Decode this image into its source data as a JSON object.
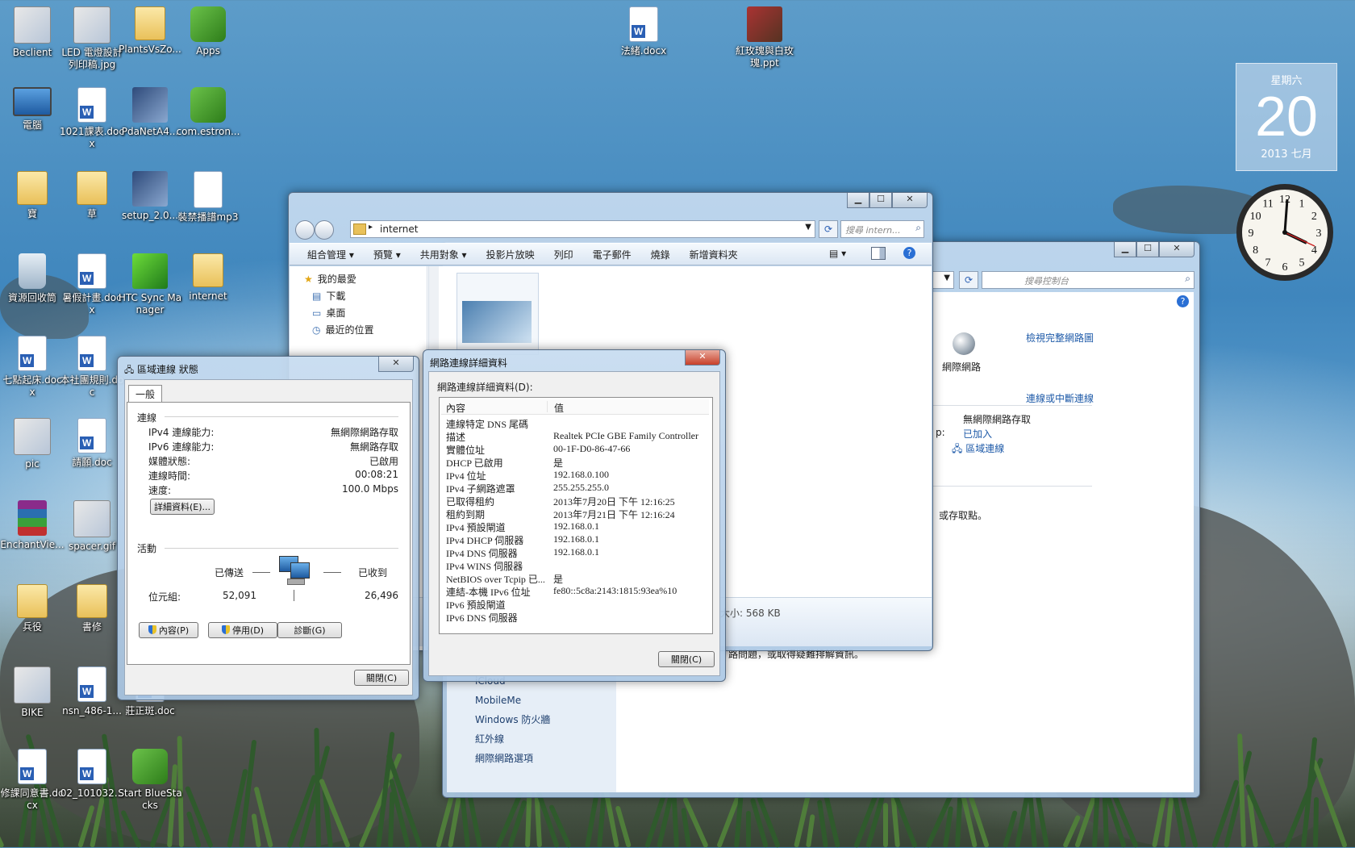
{
  "desktop": {
    "icons": [
      {
        "label": "Beclient",
        "type": "img"
      },
      {
        "label": "LED 電燈設計列印稿.jpg",
        "type": "img"
      },
      {
        "label": "PlantsVsZo...",
        "type": "folder"
      },
      {
        "label": "Apps",
        "type": "app"
      },
      {
        "label": "電腦",
        "type": "pc"
      },
      {
        "label": "1021課表.docx",
        "type": "doc"
      },
      {
        "label": "PdaNetA4...",
        "type": "setup"
      },
      {
        "label": "com.estron...",
        "type": "app"
      },
      {
        "label": "寶",
        "type": "folder"
      },
      {
        "label": "草",
        "type": "folder"
      },
      {
        "label": "setup_2.0...",
        "type": "setup"
      },
      {
        "label": "裝禁播譜mp3",
        "type": "media"
      },
      {
        "label": "資源回收筒",
        "type": "bin"
      },
      {
        "label": "暑假計畫.docx",
        "type": "doc"
      },
      {
        "label": "HTC Sync Manager",
        "type": "htc"
      },
      {
        "label": "internet",
        "type": "folder"
      },
      {
        "label": "七點起床.docx",
        "type": "doc"
      },
      {
        "label": "本社團規則.doc",
        "type": "doc"
      },
      {
        "label": "pic",
        "type": "img"
      },
      {
        "label": "請願.doc",
        "type": "doc"
      },
      {
        "label": "EnchantVie...",
        "type": "rar"
      },
      {
        "label": "spacer.gif",
        "type": "img"
      },
      {
        "label": "兵役",
        "type": "folder"
      },
      {
        "label": "書修",
        "type": "folder"
      },
      {
        "label": "BIKE",
        "type": "img"
      },
      {
        "label": "nsn_486-1...",
        "type": "doc"
      },
      {
        "label": "莊正斑.doc",
        "type": "doc"
      },
      {
        "label": "修課同意書.docx",
        "type": "doc"
      },
      {
        "label": "02_101032...",
        "type": "doc"
      },
      {
        "label": "Start BlueStacks",
        "type": "app"
      },
      {
        "label": "法緒.docx",
        "type": "doc"
      },
      {
        "label": "紅玫瑰與白玫瑰.ppt",
        "type": "ppt"
      }
    ]
  },
  "calendar_gadget": {
    "weekday": "星期六",
    "day": "20",
    "month": "2013 七月"
  },
  "clock_gadget": {
    "numbers": [
      "12",
      "1",
      "2",
      "3",
      "4",
      "5",
      "6",
      "7",
      "8",
      "9",
      "10",
      "11"
    ]
  },
  "explorer": {
    "address": "internet",
    "search_placeholder": "搜尋 intern...",
    "toolbar": [
      "組合管理",
      "預覽",
      "共用對象",
      "投影片放映",
      "列印",
      "電子郵件",
      "燒錄",
      "新增資料夾"
    ],
    "nav_items": [
      "我的最愛",
      "下載",
      "桌面",
      "最近的位置"
    ],
    "details_size": "大小: 568 KB"
  },
  "control_panel": {
    "search_placeholder": "搜尋控制台",
    "view_full_map": "檢視完整網路圖",
    "internet_label": "網際網路",
    "connect_disconnect": "連線或中斷連線",
    "access_type": "無網際網路存取",
    "joined": "已加入",
    "connection_link": "區域連線",
    "access_point_text": "或存取點。",
    "troubleshoot_text": "路問題，或取得疑難排解資訊。",
    "see_also": [
      "iCloud",
      "MobileMe",
      "Windows 防火牆",
      "紅外線",
      "網際網路選項"
    ]
  },
  "status_dialog": {
    "title": "區域連線 狀態",
    "tab": "一般",
    "section_connection": "連線",
    "rows": [
      {
        "label": "IPv4 連線能力:",
        "value": "無網際網路存取"
      },
      {
        "label": "IPv6 連線能力:",
        "value": "無網路存取"
      },
      {
        "label": "媒體狀態:",
        "value": "已啟用"
      },
      {
        "label": "連線時間:",
        "value": "00:08:21"
      },
      {
        "label": "速度:",
        "value": "100.0 Mbps"
      }
    ],
    "details_button": "詳細資料(E)...",
    "section_activity": "活動",
    "sent_label": "已傳送",
    "received_label": "已收到",
    "bytes_label": "位元組:",
    "bytes_sent": "52,091",
    "bytes_received": "26,496",
    "buttons": [
      "內容(P)",
      "停用(D)",
      "診斷(G)"
    ],
    "close_button": "關閉(C)"
  },
  "details_dialog": {
    "title": "網路連線詳細資料",
    "heading": "網路連線詳細資料(D):",
    "col_property": "內容",
    "col_value": "值",
    "rows": [
      {
        "k": "連線特定 DNS 尾碼",
        "v": ""
      },
      {
        "k": "描述",
        "v": "Realtek PCIe GBE Family Controller"
      },
      {
        "k": "實體位址",
        "v": "00-1F-D0-86-47-66"
      },
      {
        "k": "DHCP 已啟用",
        "v": "是"
      },
      {
        "k": "IPv4 位址",
        "v": "192.168.0.100"
      },
      {
        "k": "IPv4 子網路遮罩",
        "v": "255.255.255.0"
      },
      {
        "k": "已取得租約",
        "v": "2013年7月20日 下午 12:16:25"
      },
      {
        "k": "租約到期",
        "v": "2013年7月21日 下午 12:16:24"
      },
      {
        "k": "IPv4 預設閘道",
        "v": "192.168.0.1"
      },
      {
        "k": "IPv4 DHCP 伺服器",
        "v": "192.168.0.1"
      },
      {
        "k": "IPv4 DNS 伺服器",
        "v": "192.168.0.1"
      },
      {
        "k": "IPv4 WINS 伺服器",
        "v": ""
      },
      {
        "k": "NetBIOS over Tcpip 已...",
        "v": "是"
      },
      {
        "k": "連結-本機 IPv6 位址",
        "v": "fe80::5c8a:2143:1815:93ea%10"
      },
      {
        "k": "IPv6 預設閘道",
        "v": ""
      },
      {
        "k": "IPv6 DNS 伺服器",
        "v": ""
      }
    ],
    "close_button": "關閉(C)"
  }
}
